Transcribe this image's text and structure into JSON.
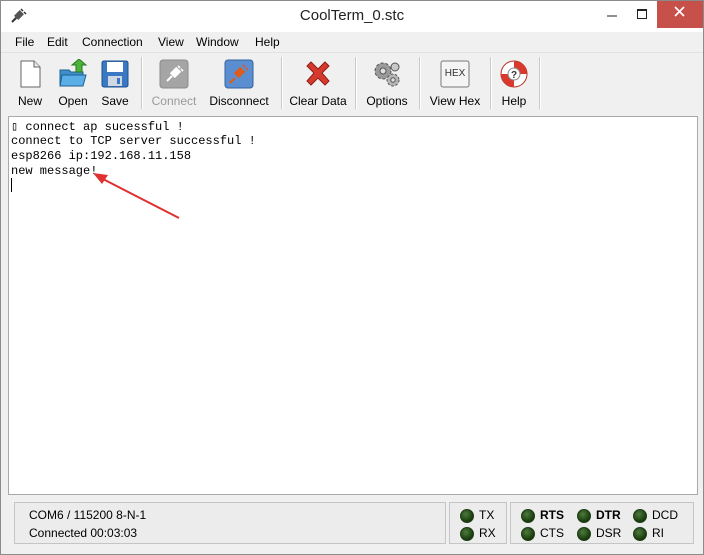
{
  "window": {
    "title": "CoolTerm_0.stc"
  },
  "menu": [
    "File",
    "Edit",
    "Connection",
    "View",
    "Window",
    "Help"
  ],
  "toolbar": {
    "new": "New",
    "open": "Open",
    "save": "Save",
    "connect": "Connect",
    "disconnect": "Disconnect",
    "clear_data": "Clear Data",
    "options": "Options",
    "view_hex": "View Hex",
    "hex_icon_text": "HEX",
    "help": "Help"
  },
  "terminal": {
    "lines": [
      "▯ connect ap sucessful !",
      "connect to TCP server successful !",
      "esp8266 ip:192.168.11.158",
      "new message!"
    ]
  },
  "status": {
    "port_settings": "COM6 / 115200 8-N-1",
    "connection": "Connected 00:03:03",
    "leds": {
      "tx": "TX",
      "rx": "RX",
      "rts": "RTS",
      "cts": "CTS",
      "dtr": "DTR",
      "dsr": "DSR",
      "dcd": "DCD",
      "ri": "RI"
    }
  },
  "colors": {
    "close_button": "#c7504b",
    "annotation_arrow": "#e03030",
    "led_on": "#2a5a1a"
  },
  "icons": {
    "app": "plug-icon",
    "new": "new-document-icon",
    "open": "open-folder-icon",
    "save": "floppy-disk-icon",
    "connect": "plug-connect-icon",
    "disconnect": "plug-disconnect-icon",
    "clear_data": "red-x-icon",
    "options": "gears-icon",
    "view_hex": "hex-icon",
    "help": "lifebuoy-icon"
  }
}
